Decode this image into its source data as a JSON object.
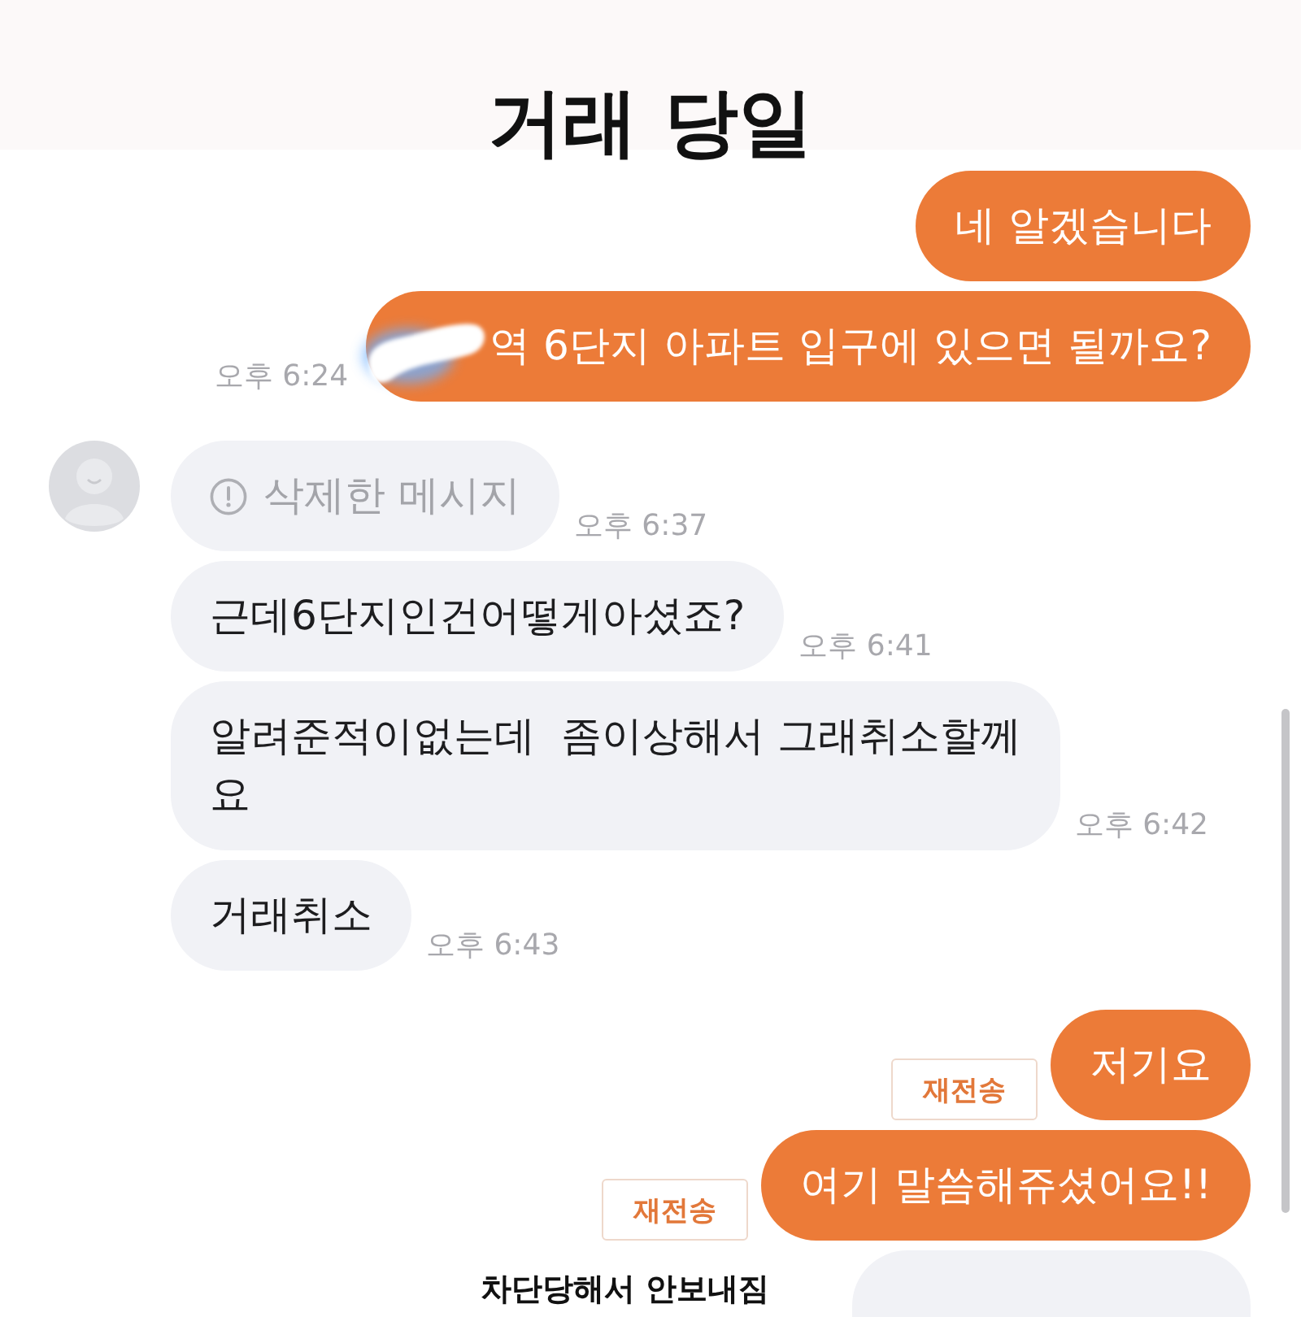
{
  "header": {
    "title": "거래 당일"
  },
  "messages": [
    {
      "kind": "text",
      "mine": true,
      "text": "네 알겠습니다",
      "redacted": false
    },
    {
      "kind": "text",
      "mine": true,
      "text": "역 6단지 아파트 입구에 있으면 될까요?",
      "time": "오후 6:24",
      "redacted": true
    },
    {
      "kind": "deleted",
      "mine": false,
      "text": "삭제한 메시지",
      "time": "오후 6:37",
      "avatar": true
    },
    {
      "kind": "text",
      "mine": false,
      "text": "근데6단지인건어떻게아셨죠?",
      "time": "오후 6:41",
      "redacted": false
    },
    {
      "kind": "text",
      "mine": false,
      "lines": [
        "알려준적이없는데  좀이상해서 그래취소할께",
        "요"
      ],
      "time": "오후 6:42",
      "redacted": false
    },
    {
      "kind": "text",
      "mine": false,
      "text": "거래취소",
      "time": "오후 6:43",
      "redacted": false
    },
    {
      "kind": "text",
      "mine": true,
      "text": "저기요",
      "retry": "재전송",
      "redacted": false
    },
    {
      "kind": "text",
      "mine": true,
      "text": "여기 말씀해쥬셨어요!!",
      "retry": "재전송",
      "redacted": false
    },
    {
      "kind": "cut_off",
      "mine": true
    }
  ],
  "caption": "차단당해서 안보내짐"
}
